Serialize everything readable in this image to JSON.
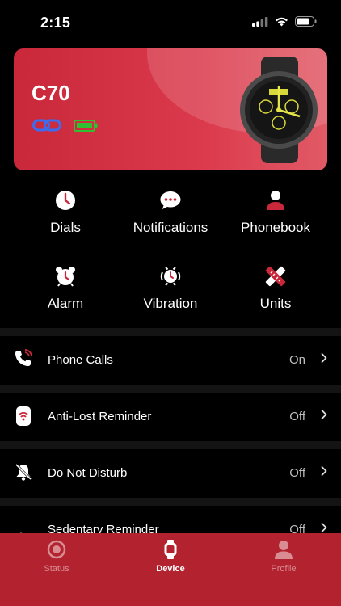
{
  "status_bar": {
    "time": "2:15"
  },
  "device": {
    "name": "C70",
    "connection_icon": "link-icon",
    "battery_icon": "battery-icon",
    "battery_color": "#2fc12f"
  },
  "features": [
    {
      "label": "Dials",
      "icon": "clock-icon"
    },
    {
      "label": "Notifications",
      "icon": "chat-bubble-icon"
    },
    {
      "label": "Phonebook",
      "icon": "person-icon"
    },
    {
      "label": "Alarm",
      "icon": "alarm-clock-icon"
    },
    {
      "label": "Vibration",
      "icon": "vibration-icon"
    },
    {
      "label": "Units",
      "icon": "ruler-pencil-icon"
    }
  ],
  "settings": [
    {
      "label": "Phone Calls",
      "value": "On",
      "icon": "phone-icon"
    },
    {
      "label": "Anti-Lost Reminder",
      "value": "Off",
      "icon": "anti-lost-icon"
    },
    {
      "label": "Do Not Disturb",
      "value": "Off",
      "icon": "bell-off-icon"
    },
    {
      "label": "Sedentary Reminder",
      "value": "Off",
      "icon": "info-icon"
    }
  ],
  "tabs": [
    {
      "label": "Status",
      "icon": "status-icon",
      "active": false
    },
    {
      "label": "Device",
      "icon": "watch-icon",
      "active": true
    },
    {
      "label": "Profile",
      "icon": "profile-icon",
      "active": false
    }
  ],
  "colors": {
    "accent": "#b2232f",
    "card": "#d63343",
    "background": "#000000",
    "divider": "#141414"
  }
}
